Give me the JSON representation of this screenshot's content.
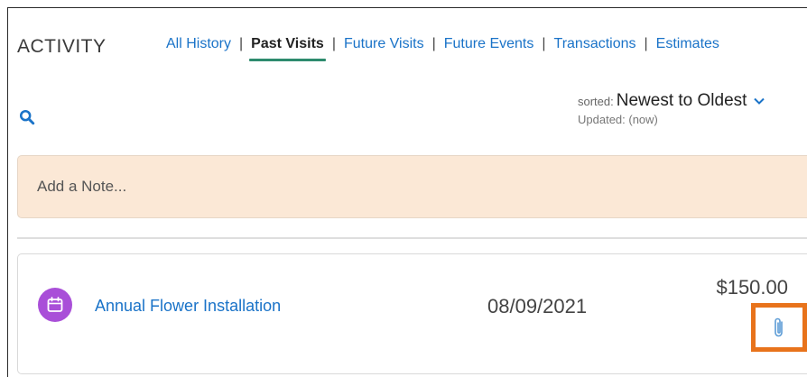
{
  "header": {
    "title": "ACTIVITY",
    "tabs": [
      {
        "label": "All History",
        "active": false
      },
      {
        "label": "Past Visits",
        "active": true
      },
      {
        "label": "Future Visits",
        "active": false
      },
      {
        "label": "Future Events",
        "active": false
      },
      {
        "label": "Transactions",
        "active": false
      },
      {
        "label": "Estimates",
        "active": false
      }
    ],
    "separator": "|"
  },
  "toolbar": {
    "search_icon": "search-icon",
    "sort_label": "sorted:",
    "sort_value": "Newest to Oldest",
    "updated": "Updated: (now)"
  },
  "note": {
    "placeholder": "Add a Note..."
  },
  "visits": [
    {
      "title": "Annual Flower Installation",
      "date": "08/09/2021",
      "amount": "$150.00",
      "icon": "calendar-icon",
      "attachment_icon": "paperclip-icon"
    }
  ],
  "colors": {
    "link": "#1a73c8",
    "active_underline": "#2e8b6e",
    "note_bg": "#fbe8d6",
    "visit_icon_bg": "#a94fd8",
    "highlight": "#e8731b"
  }
}
